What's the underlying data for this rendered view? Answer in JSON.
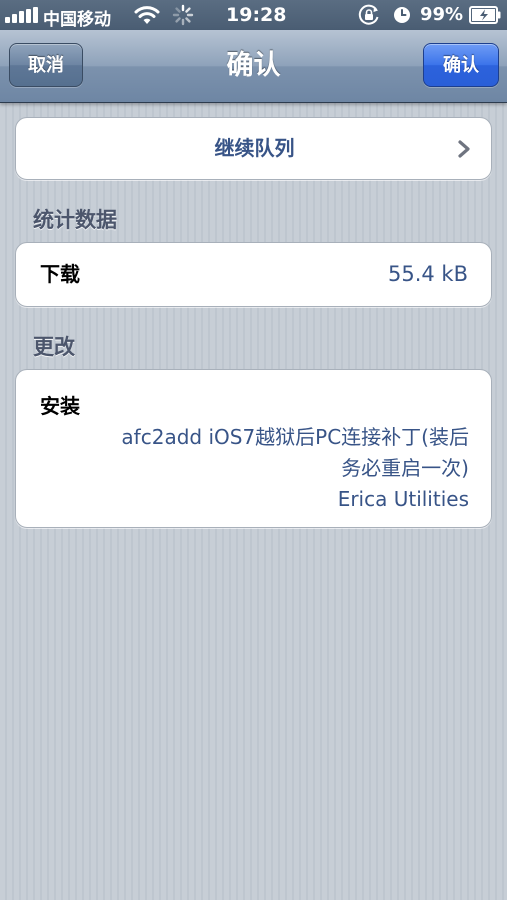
{
  "status_bar": {
    "carrier": "中国移动",
    "time": "19:28",
    "battery": "99%"
  },
  "nav": {
    "title": "确认",
    "cancel_label": "取消",
    "confirm_label": "确认"
  },
  "queue": {
    "label": "继续队列"
  },
  "stats": {
    "header": "统计数据",
    "download_label": "下载",
    "download_value": "55.4 kB"
  },
  "changes": {
    "header": "更改",
    "action_label": "安装",
    "package_line1": "afc2add iOS7越狱后PC连接补丁(装后",
    "package_line2": "务必重启一次)",
    "author": "Erica Utilities"
  },
  "icons": {
    "signal": "signal-bars-icon",
    "wifi": "wifi-icon",
    "activity": "spinner-icon",
    "rotation_lock": "rotation-lock-icon",
    "alarm": "alarm-icon",
    "battery": "battery-icon",
    "chevron": "chevron-right-icon"
  },
  "colors": {
    "accent_blue": "#2c62dc",
    "value_text": "#385487",
    "section_header": "#4c566c",
    "nav_bar": "#7c92ad"
  }
}
